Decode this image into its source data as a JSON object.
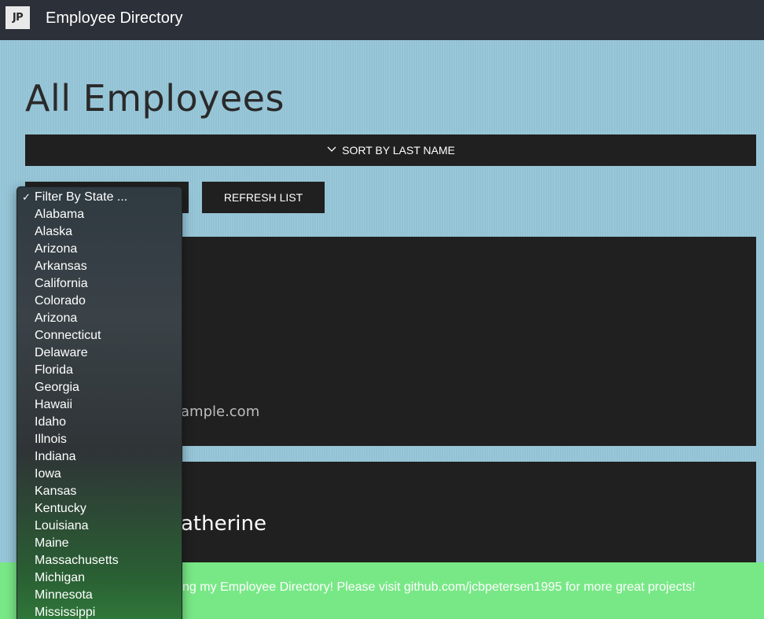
{
  "navbar": {
    "logo": "JP",
    "brand": "Employee Directory"
  },
  "page_title": "All Employees",
  "sort_button": {
    "label": "SORT BY LAST NAME",
    "icon": "chevron-down-icon"
  },
  "refresh_button": {
    "label": "REFRESH LIST"
  },
  "cards": {
    "card1_email_fragment": "ample.com",
    "card2_name_fragment": "atherine"
  },
  "footer": {
    "text": "ng my Employee Directory! Please visit github.com/jcbpetersen1995 for more great projects!"
  },
  "state_filter": {
    "check_mark": "✓",
    "selected": "Filter By State ...",
    "options": [
      "Alabama",
      "Alaska",
      "Arizona",
      "Arkansas",
      "California",
      "Colorado",
      "Arizona",
      "Connecticut",
      "Delaware",
      "Florida",
      "Georgia",
      "Hawaii",
      "Idaho",
      "Illnois",
      "Indiana",
      "Iowa",
      "Kansas",
      "Kentucky",
      "Louisiana",
      "Maine",
      "Massachusetts",
      "Michigan",
      "Minnesota",
      "Mississippi"
    ]
  }
}
